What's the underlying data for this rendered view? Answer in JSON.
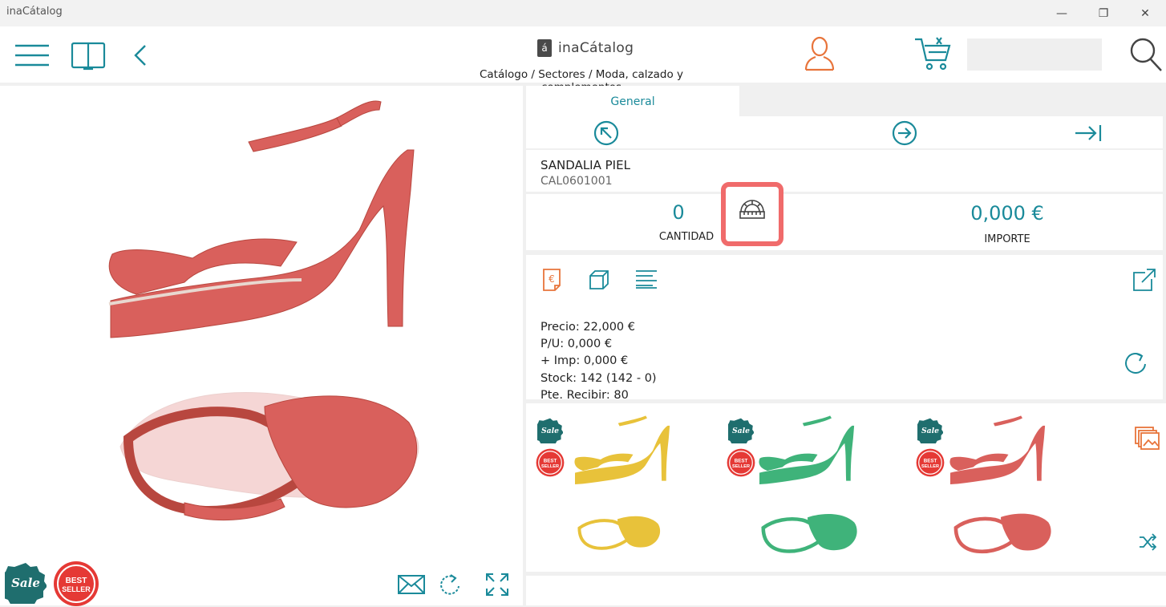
{
  "window": {
    "title": "inaCátalog",
    "minimize": "—",
    "maximize": "❐",
    "close": "✕"
  },
  "header": {
    "brand_mark": "á",
    "brand_name": "inaCátalog",
    "breadcrumb": "Catálogo / Sectores / Moda, calzado y complementos",
    "search_placeholder": ""
  },
  "tabs": [
    {
      "label": "General"
    }
  ],
  "product": {
    "name": "SANDALIA PIEL",
    "code": "CAL0601001",
    "quantity": "0",
    "quantity_label": "CANTIDAD",
    "amount": "0,000 €",
    "amount_label": "IMPORTE"
  },
  "details": {
    "price": "Precio: 22,000 €",
    "unit_price": "P/U: 0,000 €",
    "tax": "+ Imp: 0,000 €",
    "stock": "Stock: 142 (142 - 0)",
    "pending": "Pte. Recibir: 80"
  },
  "badges": {
    "sale": "Sale",
    "best": "BEST",
    "seller": "SELLER"
  },
  "related": [
    {
      "color": "#e8c23a"
    },
    {
      "color": "#3fb37a"
    },
    {
      "color": "#d9605c"
    }
  ],
  "colors": {
    "accent": "#1a8a9a",
    "orange": "#e8743b",
    "highlight": "#f06b6b",
    "shoe": "#d9605c"
  }
}
